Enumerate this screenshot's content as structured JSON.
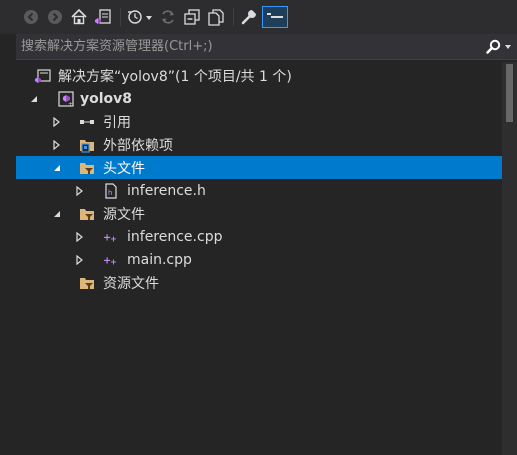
{
  "toolbar": {
    "buttons": [
      {
        "name": "back-button",
        "icon": "back-arrow-icon"
      },
      {
        "name": "forward-button",
        "icon": "forward-arrow-icon"
      },
      {
        "name": "home-button",
        "icon": "home-icon"
      },
      {
        "name": "switch-views-button",
        "icon": "switch-views-icon"
      },
      {
        "name": "pending-changes-filter-button",
        "icon": "clock-filter-icon"
      },
      {
        "name": "sync-button",
        "icon": "sync-icon"
      },
      {
        "name": "collapse-all-button",
        "icon": "collapse-all-icon"
      },
      {
        "name": "show-all-files-button",
        "icon": "show-all-files-icon"
      },
      {
        "name": "properties-button",
        "icon": "wrench-icon"
      },
      {
        "name": "preview-selected-button",
        "icon": "preview-icon"
      }
    ]
  },
  "search": {
    "placeholder": "搜索解决方案资源管理器(Ctrl+;)",
    "icon": "search-icon"
  },
  "tree": {
    "items": [
      {
        "label": "解决方案“yolov8”(1 个项目/共 1 个)",
        "icon": "solution-icon",
        "level": 0,
        "expander": "none"
      },
      {
        "label": "yolov8",
        "icon": "cpp-project-icon",
        "level": 1,
        "expander": "expanded",
        "bold": true
      },
      {
        "label": "引用",
        "icon": "references-icon",
        "level": 2,
        "expander": "collapsed"
      },
      {
        "label": "外部依赖项",
        "icon": "external-deps-folder-icon",
        "level": 2,
        "expander": "collapsed"
      },
      {
        "label": "头文件",
        "icon": "filter-folder-icon",
        "level": 2,
        "expander": "expanded",
        "selected": true
      },
      {
        "label": "inference.h",
        "icon": "header-file-icon",
        "level": 3,
        "expander": "collapsed"
      },
      {
        "label": "源文件",
        "icon": "filter-folder-icon",
        "level": 2,
        "expander": "expanded"
      },
      {
        "label": "inference.cpp",
        "icon": "cpp-file-icon",
        "level": 3,
        "expander": "collapsed"
      },
      {
        "label": "main.cpp",
        "icon": "cpp-file-icon",
        "level": 3,
        "expander": "collapsed"
      },
      {
        "label": "资源文件",
        "icon": "filter-folder-icon",
        "level": 2,
        "expander": "none"
      }
    ]
  },
  "colors": {
    "selection": "#007acc",
    "background": "#252526",
    "toolbar": "#2d2d30",
    "accent_purple": "#c586f7",
    "folder_yellow": "#dcb67a"
  }
}
